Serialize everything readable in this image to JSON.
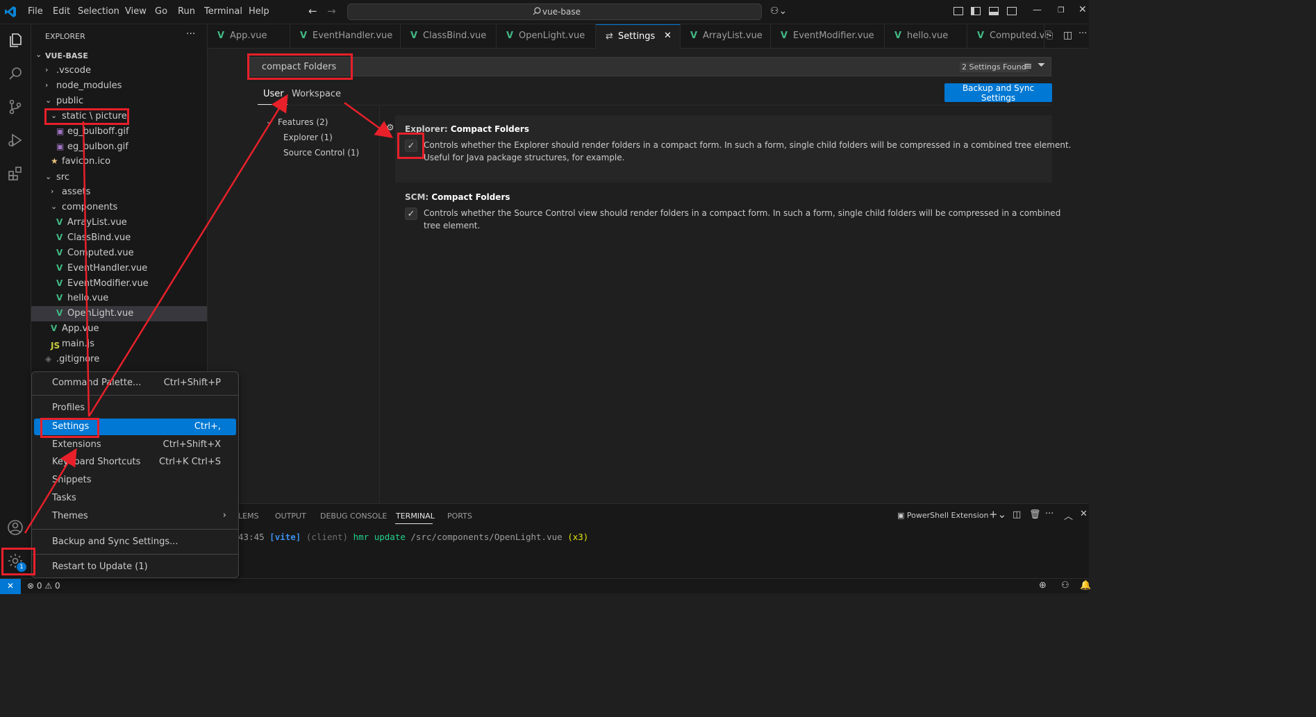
{
  "titlebar": {
    "menu": [
      "File",
      "Edit",
      "Selection",
      "View",
      "Go",
      "Run",
      "Terminal",
      "Help"
    ],
    "search": "vue-base"
  },
  "sidebar": {
    "title": "EXPLORER",
    "more": "···",
    "root": "VUE-BASE",
    "items": [
      {
        "label": ".vscode",
        "kind": "folder-closed"
      },
      {
        "label": "node_modules",
        "kind": "folder-closed"
      },
      {
        "label": "public",
        "kind": "folder-open"
      },
      {
        "label": "static \\ picture",
        "kind": "folder-open"
      },
      {
        "label": "eg_bulboff.gif",
        "kind": "gif"
      },
      {
        "label": "eg_bulbon.gif",
        "kind": "gif"
      },
      {
        "label": "favicon.ico",
        "kind": "ico"
      },
      {
        "label": "src",
        "kind": "folder-open"
      },
      {
        "label": "assets",
        "kind": "folder-closed"
      },
      {
        "label": "components",
        "kind": "folder-open"
      },
      {
        "label": "ArrayList.vue",
        "kind": "vue"
      },
      {
        "label": "ClassBind.vue",
        "kind": "vue"
      },
      {
        "label": "Computed.vue",
        "kind": "vue"
      },
      {
        "label": "EventHandler.vue",
        "kind": "vue"
      },
      {
        "label": "EventModifier.vue",
        "kind": "vue"
      },
      {
        "label": "hello.vue",
        "kind": "vue"
      },
      {
        "label": "OpenLight.vue",
        "kind": "vue"
      },
      {
        "label": "App.vue",
        "kind": "vue"
      },
      {
        "label": "main.js",
        "kind": "js"
      },
      {
        "label": ".gitignore",
        "kind": "git"
      }
    ]
  },
  "tabs": [
    "App.vue",
    "EventHandler.vue",
    "ClassBind.vue",
    "OpenLight.vue",
    "Settings",
    "ArrayList.vue",
    "EventModifier.vue",
    "hello.vue",
    "Computed.vue"
  ],
  "settings": {
    "query": "compact Folders",
    "found": "2 Settings Found",
    "scope_user": "User",
    "scope_workspace": "Workspace",
    "sync_button": "Backup and Sync Settings",
    "toc": [
      "Features (2)",
      "Explorer (1)",
      "Source Control (1)"
    ],
    "items": [
      {
        "category": "Explorer: ",
        "name": "Compact Folders",
        "desc1": "Controls whether the Explorer should render folders in a compact form. In such a form, single child folders will be compressed in a combined tree element.",
        "desc2": "Useful for Java package structures, for example.",
        "checked": true
      },
      {
        "category": "SCM: ",
        "name": "Compact Folders",
        "desc1": "Controls whether the Source Control view should render folders in a compact form. In such a form, single child folders will be compressed in a combined",
        "desc2": "tree element.",
        "checked": true
      }
    ]
  },
  "panel": {
    "tabs": [
      "LEMS",
      "OUTPUT",
      "DEBUG CONSOLE",
      "TERMINAL",
      "PORTS"
    ],
    "active_tab": "TERMINAL",
    "terminal_name": "PowerShell Extension",
    "log": {
      "time": "43:45",
      "tag": "[vite]",
      "client": "(client)",
      "msg": "hmr update",
      "path": "/src/components/OpenLight.vue",
      "count": "(x3)"
    }
  },
  "menu": {
    "items": [
      {
        "label": "Command Palette...",
        "key": "Ctrl+Shift+P"
      },
      {
        "label": "Profiles",
        "key": ""
      },
      {
        "label": "Settings",
        "key": "Ctrl+,"
      },
      {
        "label": "Extensions",
        "key": "Ctrl+Shift+X"
      },
      {
        "label": "Keyboard Shortcuts",
        "key": "Ctrl+K Ctrl+S"
      },
      {
        "label": "Snippets",
        "key": ""
      },
      {
        "label": "Tasks",
        "key": ""
      },
      {
        "label": "Themes",
        "key": ""
      },
      {
        "label": "Backup and Sync Settings...",
        "key": ""
      },
      {
        "label": "Restart to Update (1)",
        "key": ""
      }
    ]
  },
  "statusbar": {
    "errors": "0",
    "warnings": "0"
  },
  "manage_badge": "1",
  "colors": {
    "accent": "#0078d4",
    "annotation": "#e8202a",
    "vue": "#41b883"
  }
}
